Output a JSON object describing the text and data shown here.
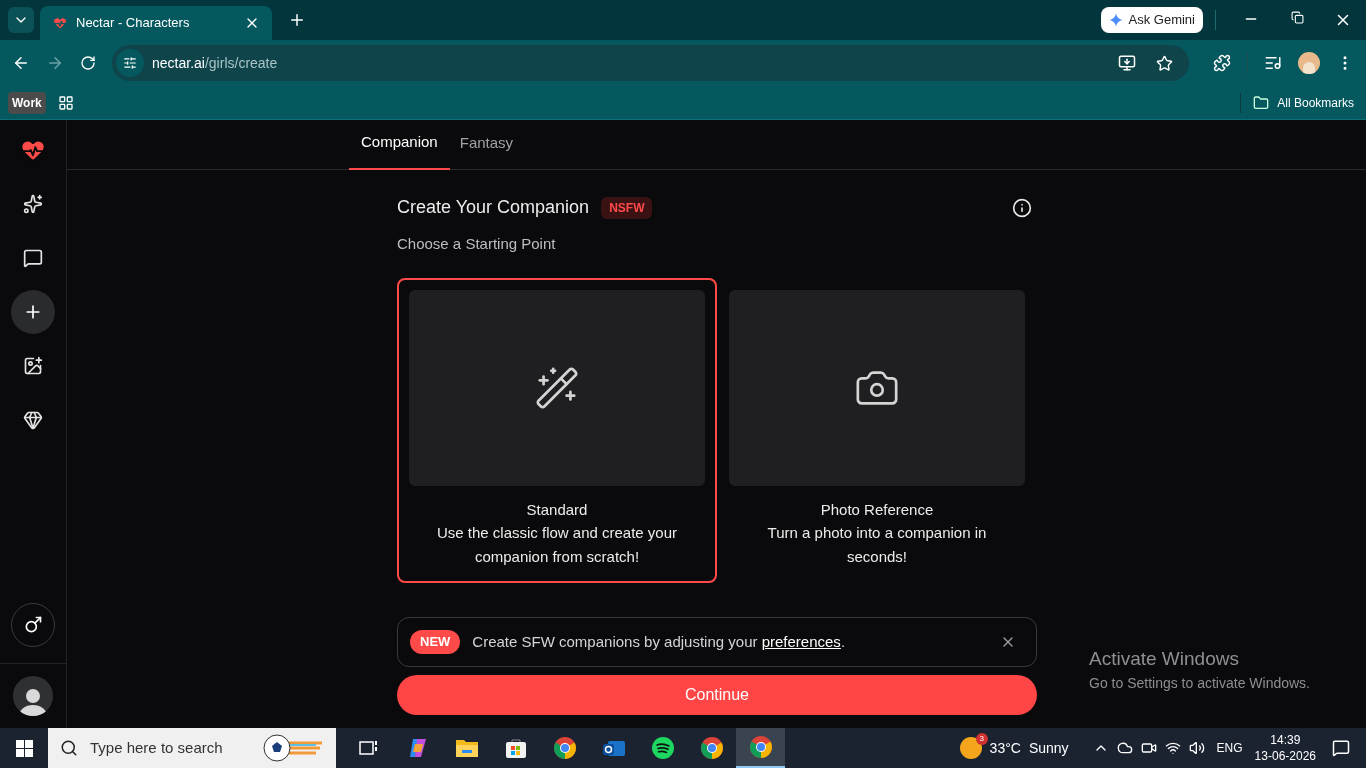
{
  "browser": {
    "tab_title": "Nectar - Characters",
    "url_host": "nectar.ai",
    "url_path": "/girls/create",
    "gemini": "Ask Gemini",
    "bookmark_folder_label": "Work",
    "all_bookmarks": "All Bookmarks"
  },
  "sidebar": {
    "items": [
      {
        "kind": "logo",
        "selected": false
      },
      {
        "kind": "sparkles",
        "selected": false
      },
      {
        "kind": "chat",
        "selected": false
      },
      {
        "kind": "create",
        "selected": true
      },
      {
        "kind": "image",
        "selected": false
      },
      {
        "kind": "gem",
        "selected": false
      }
    ]
  },
  "tabs": [
    {
      "label": "Companion",
      "selected": true
    },
    {
      "label": "Fantasy",
      "selected": false
    }
  ],
  "heading": "Create Your Companion",
  "badge": "NSFW",
  "subheading": "Choose a Starting Point",
  "options": [
    {
      "kind": "wand",
      "title": "Standard",
      "description": "Use the classic flow and create your companion from scratch!",
      "selected": true
    },
    {
      "kind": "camera",
      "title": "Photo Reference",
      "description": "Turn a photo into a companion in seconds!",
      "selected": false
    }
  ],
  "notice": {
    "badge": "NEW",
    "text_before": "Create SFW companions by adjusting your ",
    "link": "preferences",
    "text_after": "."
  },
  "continue": "Continue",
  "activation": {
    "title": "Activate Windows",
    "subtitle": "Go to Settings to activate Windows."
  },
  "taskbar": {
    "search_placeholder": "Type here to search",
    "apps": [
      {
        "kind": "taskview",
        "selected": false
      },
      {
        "kind": "copilot",
        "selected": false
      },
      {
        "kind": "explorer",
        "selected": false
      },
      {
        "kind": "store",
        "selected": false
      },
      {
        "kind": "chrome",
        "selected": false
      },
      {
        "kind": "outlook",
        "selected": false
      },
      {
        "kind": "spotify",
        "selected": false
      },
      {
        "kind": "chrome",
        "selected": false
      },
      {
        "kind": "chrome",
        "selected": true
      }
    ],
    "weather_badge": "3",
    "temperature": "33°C",
    "condition": "Sunny",
    "language": "ENG",
    "time": "14:39",
    "date": "13-06-2026"
  }
}
